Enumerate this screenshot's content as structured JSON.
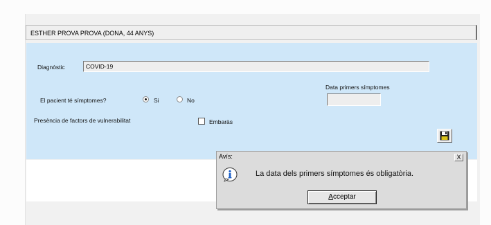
{
  "patient_header": "ESTHER PROVA PROVA  (DONA, 44 ANYS)",
  "form": {
    "diagnosis_label": "Diagnòstic",
    "diagnosis_value": "COVID-19",
    "symptoms_question": "El pacient té símptomes?",
    "option_yes": "Si",
    "option_no": "No",
    "selected": "Si",
    "first_symptoms_label": "Data primers símptomes",
    "first_symptoms_value": "",
    "vulnerability_label": "Presència de factors de vulnerabilitat",
    "pregnancy_label": "Embaràs",
    "pregnancy_checked": false
  },
  "dialog": {
    "title": "Avís:",
    "close": "X",
    "message": "La data dels primers símptomes és obligatòria.",
    "accept_first": "A",
    "accept_rest": "cceptar"
  },
  "colors": {
    "form_bg": "#cfe7f9",
    "dialog_bg": "#dcdcdc",
    "info_icon_blue": "#1b5fc7"
  },
  "icons": {
    "save": "floppy-disk-icon",
    "info": "info-icon",
    "close": "close-icon"
  }
}
